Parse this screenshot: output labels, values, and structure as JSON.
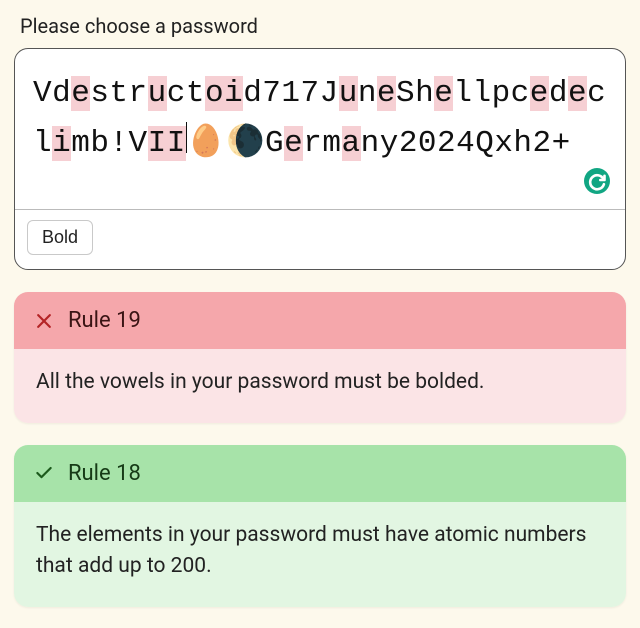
{
  "prompt": "Please choose a password",
  "password": {
    "segments": [
      {
        "t": "Vd",
        "hl": false
      },
      {
        "t": "e",
        "hl": true
      },
      {
        "t": "str",
        "hl": false
      },
      {
        "t": "u",
        "hl": true
      },
      {
        "t": "ct",
        "hl": false
      },
      {
        "t": "o",
        "hl": true
      },
      {
        "t": "i",
        "hl": true
      },
      {
        "t": "d717J",
        "hl": false
      },
      {
        "t": "u",
        "hl": true
      },
      {
        "t": "n",
        "hl": false
      },
      {
        "t": "e",
        "hl": true
      },
      {
        "t": "Sh",
        "hl": false
      },
      {
        "t": "e",
        "hl": true
      },
      {
        "t": "llpc",
        "hl": false
      },
      {
        "t": "e",
        "hl": true
      },
      {
        "t": "d",
        "hl": false
      },
      {
        "t": "e",
        "hl": true
      },
      {
        "t": "cl",
        "hl": false
      },
      {
        "t": "i",
        "hl": true
      },
      {
        "t": "mb!V",
        "hl": false
      },
      {
        "t": "II",
        "hl": true,
        "caretAfter": true
      },
      {
        "t": "🥚🌘G",
        "hl": false
      },
      {
        "t": "e",
        "hl": true
      },
      {
        "t": "rm",
        "hl": false
      },
      {
        "t": "a",
        "hl": true
      },
      {
        "t": "ny2024Qxh2+",
        "hl": false
      }
    ]
  },
  "toolbar": {
    "bold_label": "Bold"
  },
  "rules": [
    {
      "id": 19,
      "status": "fail",
      "title": "Rule 19",
      "text": "All the vowels in your password must be bolded."
    },
    {
      "id": 18,
      "status": "pass",
      "title": "Rule 18",
      "text": "The elements in your password must have atomic numbers that add up to 200."
    }
  ],
  "icons": {
    "grammarly": "grammarly-icon"
  }
}
